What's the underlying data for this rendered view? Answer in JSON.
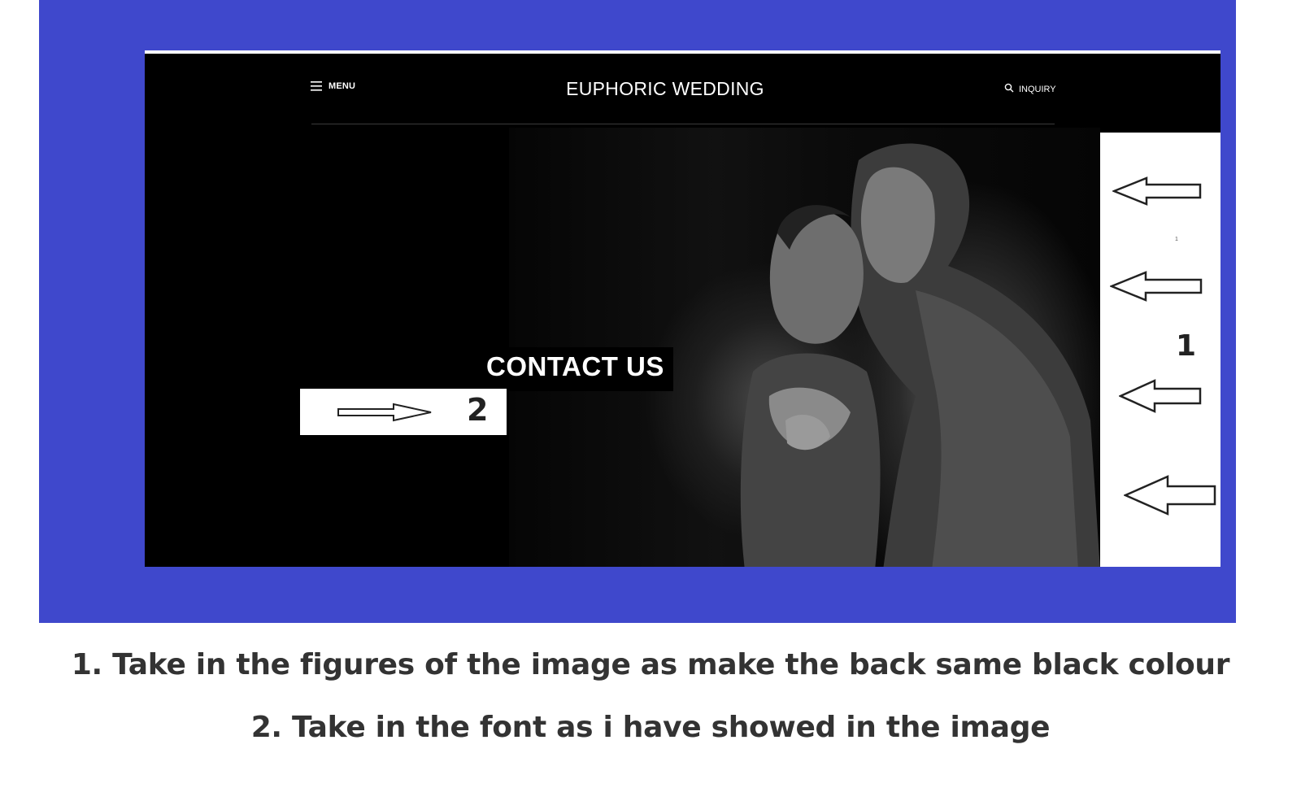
{
  "site": {
    "menu_label": "MENU",
    "title": "EUPHORIC WEDDING",
    "inquiry_label": "INQUIRY",
    "hero_heading": "CONTACT US"
  },
  "annotations": {
    "left_number": "2",
    "right_number": "1",
    "right_small_marker": "1"
  },
  "captions": [
    "1. Take in the figures of the image as make the back same black colour",
    "2. Take in the font as i have showed in the image"
  ],
  "colors": {
    "frame_blue": "#3f48cc",
    "site_background": "#000000",
    "caption_text": "#333333"
  },
  "icons": {
    "menu": "hamburger-icon",
    "inquiry": "search-icon",
    "annotation_arrows": "arrow-outline-icon"
  }
}
